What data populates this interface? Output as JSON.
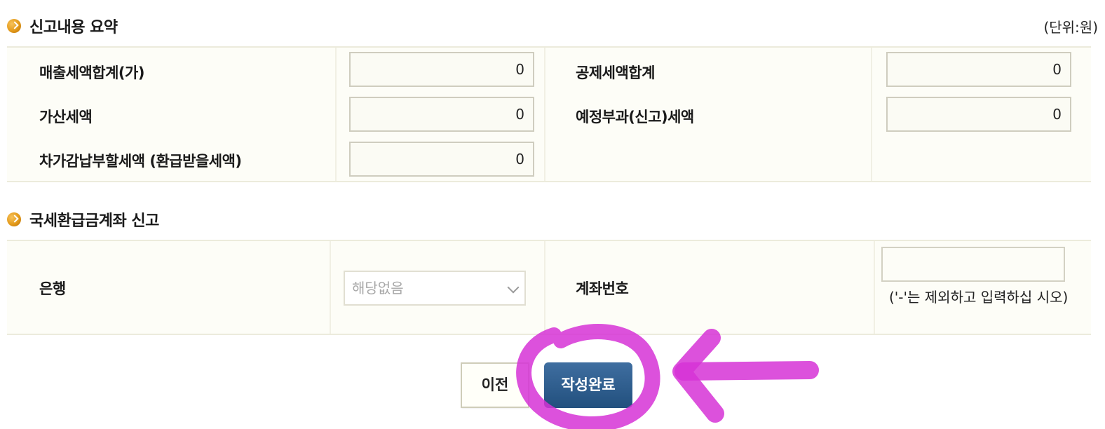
{
  "summary": {
    "title": "신고내용 요약",
    "unit": "(단위:원)",
    "rows": [
      {
        "label": "매출세액합계(가)",
        "value": "0"
      },
      {
        "label": "공제세액합계",
        "value": "0"
      },
      {
        "label": "가산세액",
        "value": "0"
      },
      {
        "label": "예정부과(신고)세액",
        "value": "0"
      },
      {
        "label": "차가감납부할세액 (환급받을세액)",
        "value": "0"
      }
    ]
  },
  "refund_account": {
    "title": "국세환급금계좌 신고",
    "bank_label": "은행",
    "bank_selected": "해당없음",
    "account_label": "계좌번호",
    "account_value": "",
    "hint": "('-'는 제외하고 입력하십 시오)"
  },
  "buttons": {
    "prev": "이전",
    "complete": "작성완료"
  },
  "colors": {
    "highlight": "#d633d6",
    "complete_button": "#2b5a89",
    "bullet": "#e39a1a"
  },
  "icons": {
    "section_bullet": "orange-circle-arrow-icon",
    "select_arrow": "chevron-down-icon"
  }
}
